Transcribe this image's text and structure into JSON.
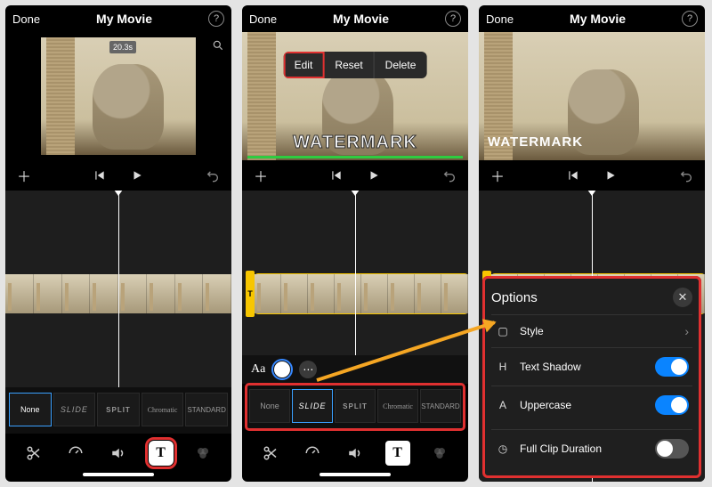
{
  "header": {
    "done": "Done",
    "title": "My Movie",
    "help": "?"
  },
  "preview": {
    "duration_badge": "20.3s",
    "watermark_text": "WATERMARK",
    "context_menu": {
      "edit": "Edit",
      "reset": "Reset",
      "delete": "Delete"
    }
  },
  "text_style_row": {
    "aa": "Aa"
  },
  "text_handle_label": "T",
  "styles": [
    {
      "label": "None"
    },
    {
      "label": "SLIDE"
    },
    {
      "label": "SPLIT"
    },
    {
      "label": "Chromatic"
    },
    {
      "label": "STANDARD"
    }
  ],
  "options_panel": {
    "title": "Options",
    "rows": [
      {
        "id": "style",
        "label": "Style",
        "icon": "A",
        "kind": "nav"
      },
      {
        "id": "shadow",
        "label": "Text Shadow",
        "icon": "H",
        "kind": "toggle",
        "on": true
      },
      {
        "id": "upper",
        "label": "Uppercase",
        "icon": "A",
        "kind": "toggle",
        "on": true
      },
      {
        "id": "fullclip",
        "label": "Full Clip Duration",
        "icon": "⏲",
        "kind": "toggle",
        "on": false
      }
    ]
  }
}
